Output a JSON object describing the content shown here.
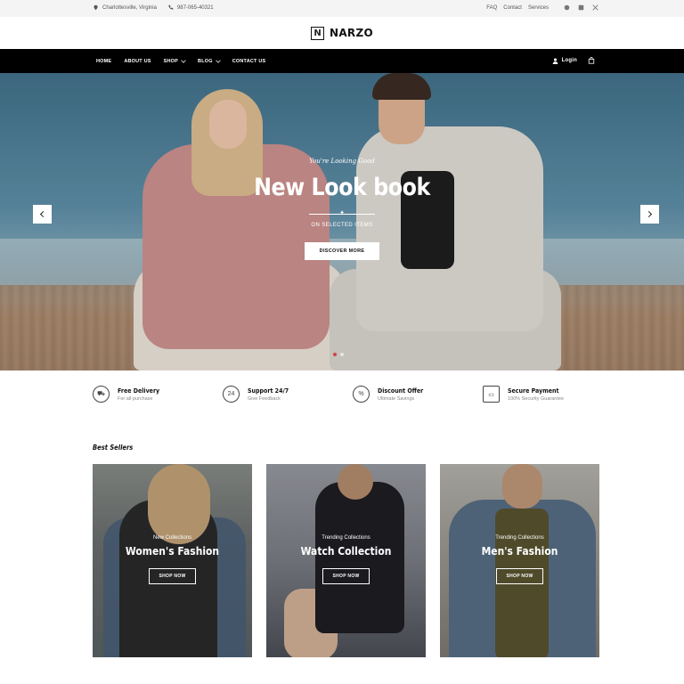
{
  "topbar": {
    "location": "Charlottesville, Virginia",
    "phone": "987-065-40321",
    "links": [
      "FAQ",
      "Contact",
      "Services"
    ],
    "social_icons": [
      "instagram-icon",
      "linkedin-icon",
      "x-icon"
    ]
  },
  "brand": {
    "logo_mark": "N",
    "name": "NARZO"
  },
  "nav": {
    "items": [
      {
        "label": "HOME"
      },
      {
        "label": "ABOUT US"
      },
      {
        "label": "SHOP"
      },
      {
        "label": "BLOG"
      },
      {
        "label": "CONTACT US"
      }
    ],
    "login_label": "Login"
  },
  "hero": {
    "eyebrow": "You're Looking Good",
    "title": "New Look book",
    "subtitle": "ON SELECTED ITEMS",
    "cta": "DISCOVER MORE"
  },
  "features": [
    {
      "title": "Free Delivery",
      "subtitle": "For all purchase",
      "icon": "delivery-icon"
    },
    {
      "title": "Support 24/7",
      "subtitle": "Give Feedback",
      "icon": "support-icon"
    },
    {
      "title": "Discount Offer",
      "subtitle": "Ultimate Savings",
      "icon": "discount-icon"
    },
    {
      "title": "Secure Payment",
      "subtitle": "100% Security Guarantee",
      "icon": "secure-payment-icon"
    }
  ],
  "best_sellers": {
    "title": "Best Sellers",
    "cards": [
      {
        "subtitle": "New Collections",
        "title": "Women's Fashion",
        "cta": "SHOP NOW"
      },
      {
        "subtitle": "Trending Collections",
        "title": "Watch Collection",
        "cta": "SHOP NOW"
      },
      {
        "subtitle": "Trending Collections",
        "title": "Men's Fashion",
        "cta": "SHOP NOW"
      }
    ]
  },
  "colors": {
    "nav_bg": "#000000",
    "accent_dot": "#cc4444",
    "page_bg": "#ffffff"
  }
}
